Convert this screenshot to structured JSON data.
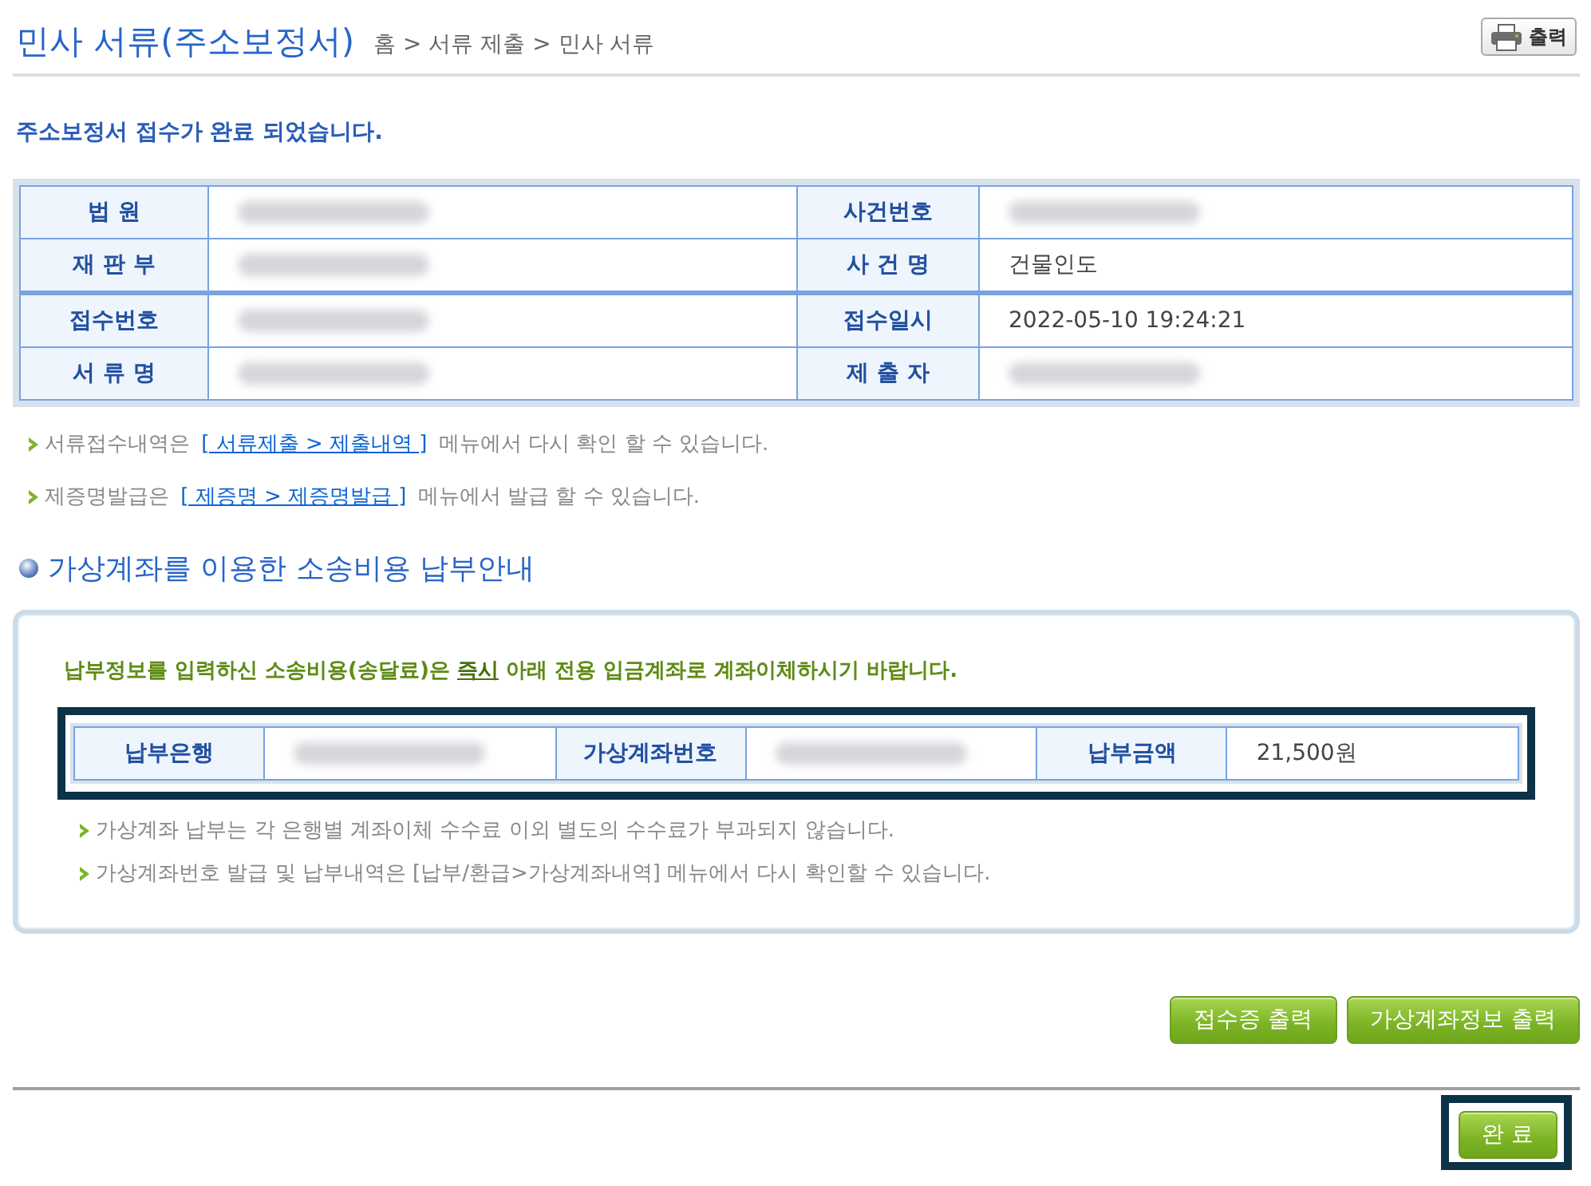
{
  "header": {
    "title": "민사 서류(주소보정서)",
    "breadcrumb": "홈 > 서류 제출 > 민사 서류",
    "print_button": {
      "label": "출력"
    }
  },
  "status_message": "주소보정서 접수가 완료 되었습니다.",
  "case_info": {
    "rows": [
      {
        "cells": [
          {
            "label": "법 원",
            "redacted": true
          },
          {
            "label": "사건번호",
            "redacted": true
          }
        ]
      },
      {
        "cells": [
          {
            "label": "재 판 부",
            "redacted": true
          },
          {
            "label": "사 건 명",
            "value": "건물인도",
            "redacted": false
          }
        ]
      },
      {
        "cells": [
          {
            "label": "접수번호",
            "redacted": true
          },
          {
            "label": "접수일시",
            "value": "2022-05-10 19:24:21",
            "redacted": false
          }
        ]
      },
      {
        "cells": [
          {
            "label": "서 류 명",
            "redacted": true
          },
          {
            "label": "제 출 자",
            "redacted": true
          }
        ]
      }
    ]
  },
  "notes": [
    {
      "before": "서류접수내역은",
      "link": "[ 서류제출 > 제출내역 ]",
      "after": "메뉴에서 다시 확인 할 수 있습니다."
    },
    {
      "before": "제증명발급은",
      "link": "[ 제증명 > 제증명발급 ]",
      "after": "메뉴에서 발급 할 수 있습니다."
    }
  ],
  "payment": {
    "heading": "가상계좌를 이용한 소송비용 납부안내",
    "instruction": {
      "before": "납부정보를 입력하신 소송비용(송달료)은",
      "emphasis": "즉시",
      "after": "아래 전용 입금계좌로 계좌이체하시기 바랍니다."
    },
    "account_table": {
      "highlighted": true,
      "cells": [
        {
          "label": "납부은행",
          "redacted": true
        },
        {
          "label": "가상계좌번호",
          "redacted": true
        },
        {
          "label": "납부금액",
          "value": "21,500원",
          "redacted": false
        }
      ]
    },
    "notes": [
      "가상계좌 납부는 각 은행별 계좌이체 수수료 이외 별도의 수수료가 부과되지 않습니다.",
      "가상계좌번호 발급 및 납부내역은 [납부/환급>가상계좌내역] 메뉴에서 다시 확인할 수 있습니다."
    ]
  },
  "action_buttons": [
    {
      "label": "접수증 출력"
    },
    {
      "label": "가상계좌정보 출력"
    }
  ],
  "footer": {
    "button": {
      "label": "완 료",
      "highlighted": true
    }
  }
}
